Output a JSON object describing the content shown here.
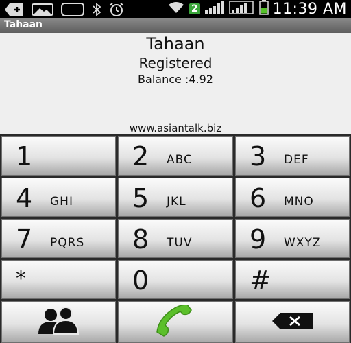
{
  "status_bar": {
    "time": "11:39 AM",
    "notification_count": "2",
    "icons": [
      "add-icon",
      "image-icon",
      "chat-bubble-icon",
      "bluetooth-icon",
      "alarm-icon",
      "wifi-icon",
      "signal-icon",
      "battery-icon"
    ]
  },
  "app": {
    "title": "Tahaan"
  },
  "info": {
    "account_name": "Tahaan",
    "registration_status": "Registered",
    "balance": "Balance :4.92",
    "website": "www.asiantalk.biz"
  },
  "keypad": {
    "keys": [
      {
        "digit": "1",
        "letters": ""
      },
      {
        "digit": "2",
        "letters": "ABC"
      },
      {
        "digit": "3",
        "letters": "DEF"
      },
      {
        "digit": "4",
        "letters": "GHI"
      },
      {
        "digit": "5",
        "letters": "JKL"
      },
      {
        "digit": "6",
        "letters": "MNO"
      },
      {
        "digit": "7",
        "letters": "PQRS"
      },
      {
        "digit": "8",
        "letters": "TUV"
      },
      {
        "digit": "9",
        "letters": "WXYZ"
      },
      {
        "digit": "*",
        "letters": ""
      },
      {
        "digit": "0",
        "letters": ""
      },
      {
        "digit": "#",
        "letters": ""
      }
    ],
    "bottom_row": [
      "contacts-icon",
      "call-icon",
      "backspace-icon"
    ],
    "colors": {
      "call_green": "#5bbf2a",
      "key_top": "#fbfbfb",
      "key_bottom": "#a8a8a8"
    }
  }
}
